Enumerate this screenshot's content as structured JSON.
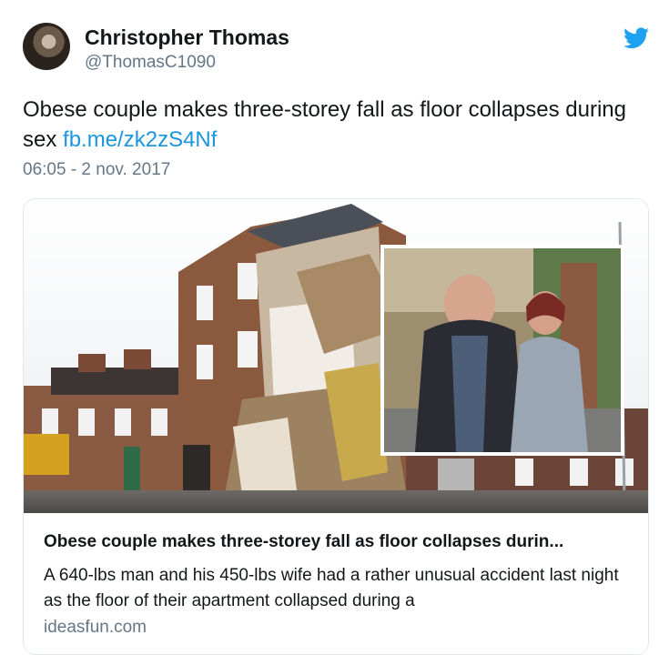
{
  "author": {
    "name": "Christopher Thomas",
    "handle": "@ThomasC1090"
  },
  "tweet": {
    "text": "Obese couple makes three-storey fall as floor collapses during sex",
    "link": "fb.me/zk2zS4Nf",
    "timestamp": "06:05 - 2 nov. 2017"
  },
  "card": {
    "title": "Obese couple makes three-storey fall as floor collapses durin...",
    "description": "A 640-lbs man and his 450-lbs wife had a rather unusual accident last night as the floor of their apartment collapsed during a",
    "domain": "ideasfun.com"
  },
  "icons": {
    "brand": "twitter-bird-icon"
  },
  "colors": {
    "link": "#1b95e0",
    "secondary_text": "#657786",
    "border": "#e1e8ed",
    "twitter_blue": "#1da1f2"
  }
}
